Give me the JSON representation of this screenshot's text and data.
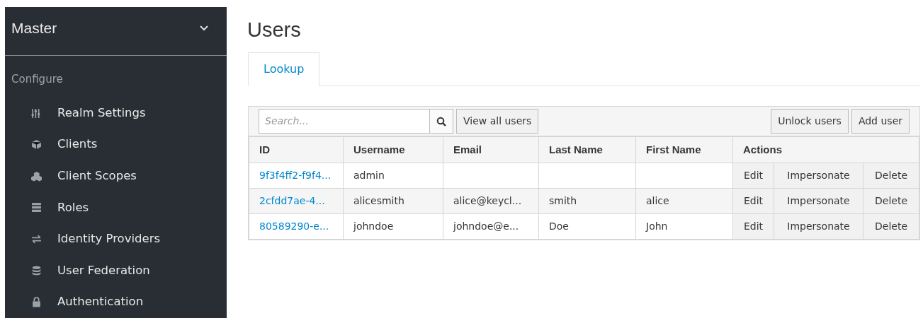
{
  "sidebar": {
    "realm": "Master",
    "section": "Configure",
    "items": [
      {
        "label": "Realm Settings"
      },
      {
        "label": "Clients"
      },
      {
        "label": "Client Scopes"
      },
      {
        "label": "Roles"
      },
      {
        "label": "Identity Providers"
      },
      {
        "label": "User Federation"
      },
      {
        "label": "Authentication"
      }
    ]
  },
  "page_title": "Users",
  "tabs": [
    {
      "label": "Lookup",
      "selected": true
    }
  ],
  "toolbar": {
    "search": {
      "placeholder": "Search..."
    },
    "view_all": "View all users",
    "unlock": "Unlock users",
    "add": "Add user"
  },
  "table": {
    "columns": [
      "ID",
      "Username",
      "Email",
      "Last Name",
      "First Name",
      "Actions"
    ],
    "rows": [
      {
        "id": "9f3f4ff2-f9f4...",
        "username": "admin",
        "email": "",
        "last_name": "",
        "first_name": "",
        "actions": [
          "Edit",
          "Impersonate",
          "Delete"
        ]
      },
      {
        "id": "2cfdd7ae-4...",
        "username": "alicesmith",
        "email": "alice@keycl...",
        "last_name": "smith",
        "first_name": "alice",
        "actions": [
          "Edit",
          "Impersonate",
          "Delete"
        ]
      },
      {
        "id": "80589290-e...",
        "username": "johndoe",
        "email": "johndoe@e...",
        "last_name": "Doe",
        "first_name": "John",
        "actions": [
          "Edit",
          "Impersonate",
          "Delete"
        ]
      }
    ]
  }
}
